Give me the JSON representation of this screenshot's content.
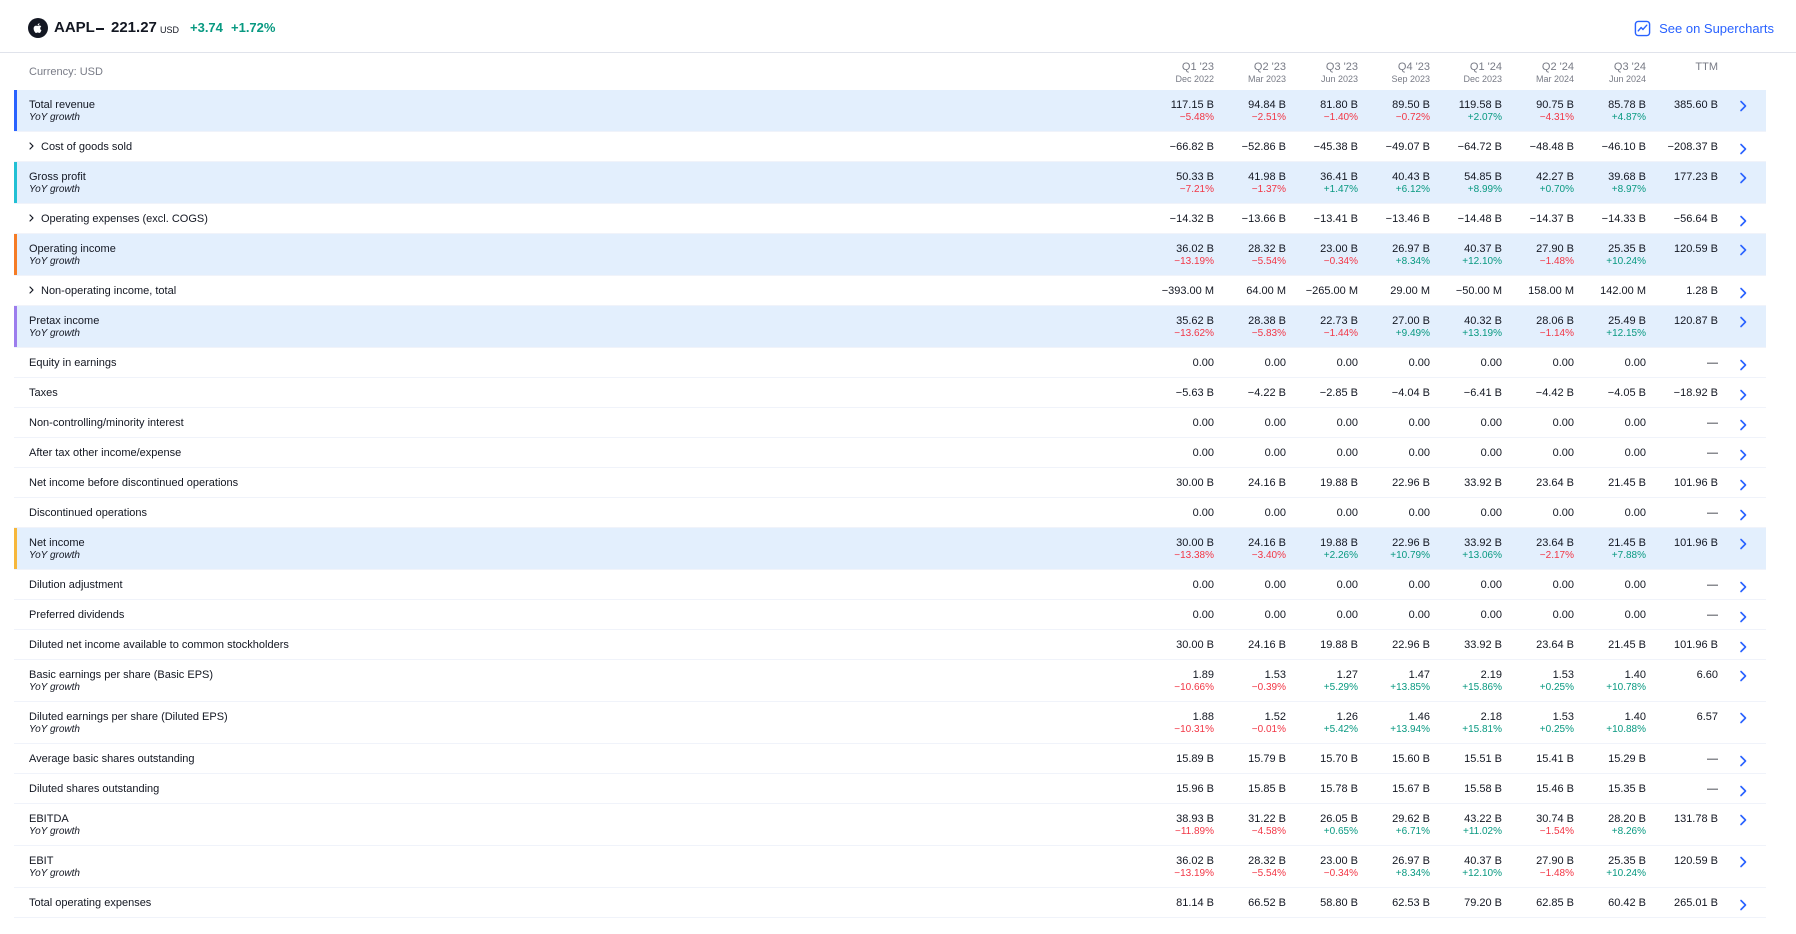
{
  "header": {
    "ticker": "AAPL",
    "price": "221.27",
    "currency": "USD",
    "change": "+3.74",
    "change_pct": "+1.72%",
    "see_label": "See on Supercharts"
  },
  "colors": {
    "positive": "#089981",
    "negative": "#f23645",
    "accent": "#2962ff",
    "highlight_bg": "#e3effd"
  },
  "table": {
    "currency_label": "Currency: USD",
    "columns": [
      {
        "q": "Q1 '23",
        "d": "Dec 2022"
      },
      {
        "q": "Q2 '23",
        "d": "Mar 2023"
      },
      {
        "q": "Q3 '23",
        "d": "Jun 2023"
      },
      {
        "q": "Q4 '23",
        "d": "Sep 2023"
      },
      {
        "q": "Q1 '24",
        "d": "Dec 2023"
      },
      {
        "q": "Q2 '24",
        "d": "Mar 2024"
      },
      {
        "q": "Q3 '24",
        "d": "Jun 2024"
      },
      {
        "q": "TTM",
        "d": ""
      }
    ],
    "rows": [
      {
        "label": "Total revenue",
        "sub": "YoY growth",
        "hl": true,
        "bar": "#2962ff",
        "values": [
          "117.15 B",
          "94.84 B",
          "81.80 B",
          "89.50 B",
          "119.58 B",
          "90.75 B",
          "85.78 B",
          "385.60 B"
        ],
        "yoy": [
          "−5.48%",
          "−2.51%",
          "−1.40%",
          "−0.72%",
          "+2.07%",
          "−4.31%",
          "+4.87%",
          ""
        ]
      },
      {
        "label": "Cost of goods sold",
        "expandable": true,
        "values": [
          "−66.82 B",
          "−52.86 B",
          "−45.38 B",
          "−49.07 B",
          "−64.72 B",
          "−48.48 B",
          "−46.10 B",
          "−208.37 B"
        ]
      },
      {
        "label": "Gross profit",
        "sub": "YoY growth",
        "hl": true,
        "bar": "#22c0d4",
        "values": [
          "50.33 B",
          "41.98 B",
          "36.41 B",
          "40.43 B",
          "54.85 B",
          "42.27 B",
          "39.68 B",
          "177.23 B"
        ],
        "yoy": [
          "−7.21%",
          "−1.37%",
          "+1.47%",
          "+6.12%",
          "+8.99%",
          "+0.70%",
          "+8.97%",
          ""
        ]
      },
      {
        "label": "Operating expenses (excl. COGS)",
        "expandable": true,
        "values": [
          "−14.32 B",
          "−13.66 B",
          "−13.41 B",
          "−13.46 B",
          "−14.48 B",
          "−14.37 B",
          "−14.33 B",
          "−56.64 B"
        ]
      },
      {
        "label": "Operating income",
        "sub": "YoY growth",
        "hl": true,
        "bar": "#f57c26",
        "values": [
          "36.02 B",
          "28.32 B",
          "23.00 B",
          "26.97 B",
          "40.37 B",
          "27.90 B",
          "25.35 B",
          "120.59 B"
        ],
        "yoy": [
          "−13.19%",
          "−5.54%",
          "−0.34%",
          "+8.34%",
          "+12.10%",
          "−1.48%",
          "+10.24%",
          ""
        ]
      },
      {
        "label": "Non-operating income, total",
        "expandable": true,
        "values": [
          "−393.00 M",
          "64.00 M",
          "−265.00 M",
          "29.00 M",
          "−50.00 M",
          "158.00 M",
          "142.00 M",
          "1.28 B"
        ]
      },
      {
        "label": "Pretax income",
        "sub": "YoY growth",
        "hl": true,
        "bar": "#9c7ded",
        "values": [
          "35.62 B",
          "28.38 B",
          "22.73 B",
          "27.00 B",
          "40.32 B",
          "28.06 B",
          "25.49 B",
          "120.87 B"
        ],
        "yoy": [
          "−13.62%",
          "−5.83%",
          "−1.44%",
          "+9.49%",
          "+13.19%",
          "−1.14%",
          "+12.15%",
          ""
        ]
      },
      {
        "label": "Equity in earnings",
        "values": [
          "0.00",
          "0.00",
          "0.00",
          "0.00",
          "0.00",
          "0.00",
          "0.00",
          "—"
        ]
      },
      {
        "label": "Taxes",
        "values": [
          "−5.63 B",
          "−4.22 B",
          "−2.85 B",
          "−4.04 B",
          "−6.41 B",
          "−4.42 B",
          "−4.05 B",
          "−18.92 B"
        ]
      },
      {
        "label": "Non-controlling/minority interest",
        "values": [
          "0.00",
          "0.00",
          "0.00",
          "0.00",
          "0.00",
          "0.00",
          "0.00",
          "—"
        ]
      },
      {
        "label": "After tax other income/expense",
        "values": [
          "0.00",
          "0.00",
          "0.00",
          "0.00",
          "0.00",
          "0.00",
          "0.00",
          "—"
        ]
      },
      {
        "label": "Net income before discontinued operations",
        "values": [
          "30.00 B",
          "24.16 B",
          "19.88 B",
          "22.96 B",
          "33.92 B",
          "23.64 B",
          "21.45 B",
          "101.96 B"
        ]
      },
      {
        "label": "Discontinued operations",
        "values": [
          "0.00",
          "0.00",
          "0.00",
          "0.00",
          "0.00",
          "0.00",
          "0.00",
          "—"
        ]
      },
      {
        "label": "Net income",
        "sub": "YoY growth",
        "hl": true,
        "bar": "#f6b73c",
        "values": [
          "30.00 B",
          "24.16 B",
          "19.88 B",
          "22.96 B",
          "33.92 B",
          "23.64 B",
          "21.45 B",
          "101.96 B"
        ],
        "yoy": [
          "−13.38%",
          "−3.40%",
          "+2.26%",
          "+10.79%",
          "+13.06%",
          "−2.17%",
          "+7.88%",
          ""
        ]
      },
      {
        "label": "Dilution adjustment",
        "values": [
          "0.00",
          "0.00",
          "0.00",
          "0.00",
          "0.00",
          "0.00",
          "0.00",
          "—"
        ]
      },
      {
        "label": "Preferred dividends",
        "values": [
          "0.00",
          "0.00",
          "0.00",
          "0.00",
          "0.00",
          "0.00",
          "0.00",
          "—"
        ]
      },
      {
        "label": "Diluted net income available to common stockholders",
        "values": [
          "30.00 B",
          "24.16 B",
          "19.88 B",
          "22.96 B",
          "33.92 B",
          "23.64 B",
          "21.45 B",
          "101.96 B"
        ]
      },
      {
        "label": "Basic earnings per share (Basic EPS)",
        "sub": "YoY growth",
        "values": [
          "1.89",
          "1.53",
          "1.27",
          "1.47",
          "2.19",
          "1.53",
          "1.40",
          "6.60"
        ],
        "yoy": [
          "−10.66%",
          "−0.39%",
          "+5.29%",
          "+13.85%",
          "+15.86%",
          "+0.25%",
          "+10.78%",
          ""
        ]
      },
      {
        "label": "Diluted earnings per share (Diluted EPS)",
        "sub": "YoY growth",
        "values": [
          "1.88",
          "1.52",
          "1.26",
          "1.46",
          "2.18",
          "1.53",
          "1.40",
          "6.57"
        ],
        "yoy": [
          "−10.31%",
          "−0.01%",
          "+5.42%",
          "+13.94%",
          "+15.81%",
          "+0.25%",
          "+10.88%",
          ""
        ]
      },
      {
        "label": "Average basic shares outstanding",
        "values": [
          "15.89 B",
          "15.79 B",
          "15.70 B",
          "15.60 B",
          "15.51 B",
          "15.41 B",
          "15.29 B",
          "—"
        ]
      },
      {
        "label": "Diluted shares outstanding",
        "values": [
          "15.96 B",
          "15.85 B",
          "15.78 B",
          "15.67 B",
          "15.58 B",
          "15.46 B",
          "15.35 B",
          "—"
        ]
      },
      {
        "label": "EBITDA",
        "sub": "YoY growth",
        "values": [
          "38.93 B",
          "31.22 B",
          "26.05 B",
          "29.62 B",
          "43.22 B",
          "30.74 B",
          "28.20 B",
          "131.78 B"
        ],
        "yoy": [
          "−11.89%",
          "−4.58%",
          "+0.65%",
          "+6.71%",
          "+11.02%",
          "−1.54%",
          "+8.26%",
          ""
        ]
      },
      {
        "label": "EBIT",
        "sub": "YoY growth",
        "values": [
          "36.02 B",
          "28.32 B",
          "23.00 B",
          "26.97 B",
          "40.37 B",
          "27.90 B",
          "25.35 B",
          "120.59 B"
        ],
        "yoy": [
          "−13.19%",
          "−5.54%",
          "−0.34%",
          "+8.34%",
          "+12.10%",
          "−1.48%",
          "+10.24%",
          ""
        ]
      },
      {
        "label": "Total operating expenses",
        "values": [
          "81.14 B",
          "66.52 B",
          "58.80 B",
          "62.53 B",
          "79.20 B",
          "62.85 B",
          "60.42 B",
          "265.01 B"
        ]
      }
    ]
  }
}
